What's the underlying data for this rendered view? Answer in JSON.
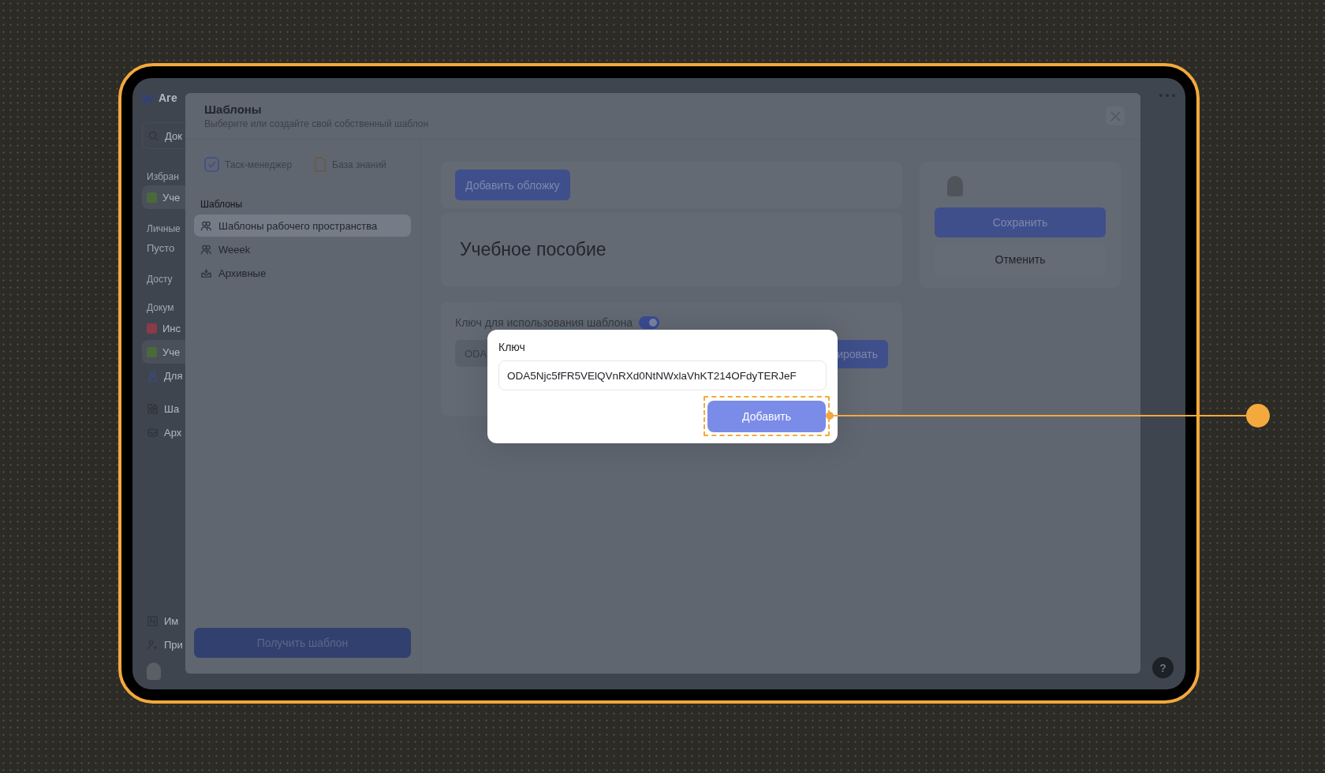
{
  "app_sidebar": {
    "workspace": "Аге",
    "search": "Док",
    "entries": [
      {
        "kind": "section",
        "label": "Избран"
      },
      {
        "kind": "item",
        "label": "Уче",
        "selected": true
      },
      {
        "kind": "section",
        "label": "Личные"
      },
      {
        "kind": "empty",
        "label": "Пусто"
      },
      {
        "kind": "section",
        "label": "Досту"
      },
      {
        "kind": "section",
        "label": "Докум"
      },
      {
        "kind": "item",
        "label": "Инс",
        "selected": false
      },
      {
        "kind": "item",
        "label": "Уче",
        "selected": true
      },
      {
        "kind": "item",
        "label": "Для",
        "selected": false
      },
      {
        "kind": "gap"
      },
      {
        "kind": "item",
        "label": "Ша",
        "selected": false
      },
      {
        "kind": "item",
        "label": "Арх",
        "selected": false
      }
    ],
    "bottom": [
      {
        "label": "Им"
      },
      {
        "label": "При"
      }
    ]
  },
  "templates_modal": {
    "title": "Шаблоны",
    "subtitle": "Выберите или создайте свой собственный шаблон",
    "sources": [
      {
        "label": "Таск-менеджер"
      },
      {
        "label": "База знаний"
      }
    ],
    "section_label": "Шаблоны",
    "items": [
      {
        "label": "Шаблоны рабочего пространства",
        "selected": true
      },
      {
        "label": "Weeek",
        "selected": false
      },
      {
        "label": "Архивные",
        "selected": false
      }
    ],
    "get_button": "Получить шаблон",
    "cover_button": "Добавить обложку",
    "doc_title": "Учебное пособие",
    "key_label": "Ключ для использования шаблона",
    "key_toggle": {
      "on": true
    },
    "key_value": "ODA",
    "copy_button": "ировать",
    "save_button": "Сохранить",
    "cancel_button": "Отменить"
  },
  "key_dialog": {
    "label": "Ключ",
    "value": "ODA5Njc5fFR5VElQVnRXd0NtNWxlaVhKT214OFdyTERJeF",
    "add_button": "Добавить"
  },
  "help_button": "?"
}
